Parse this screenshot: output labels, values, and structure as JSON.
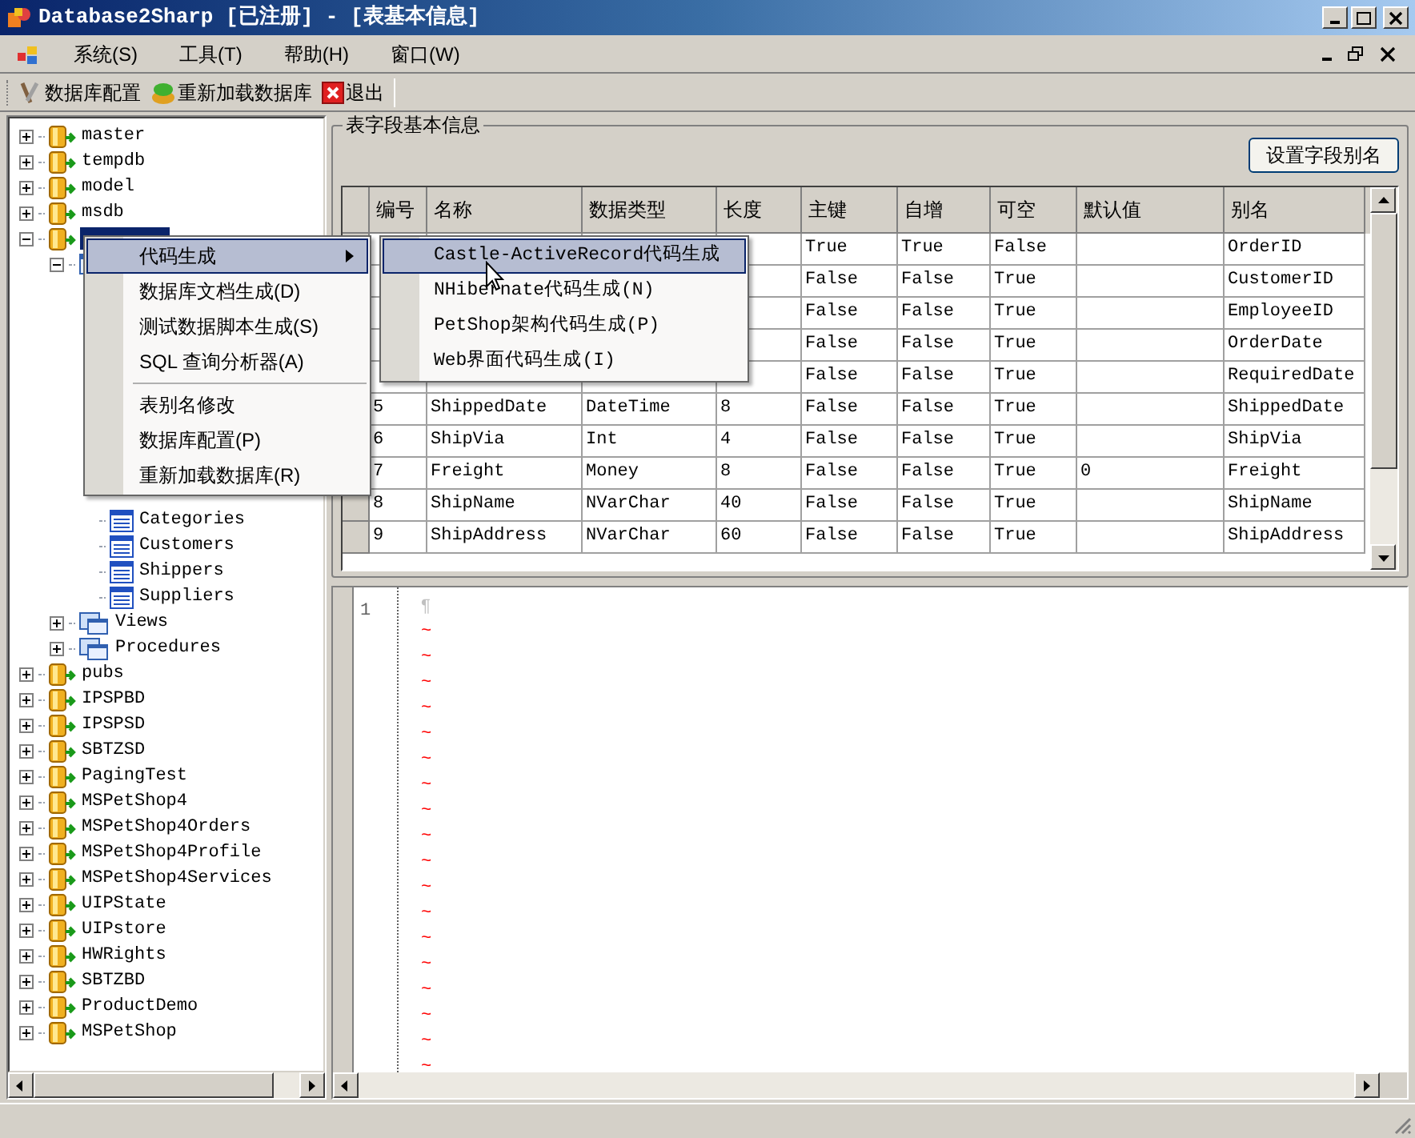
{
  "window": {
    "title": "Database2Sharp [已注册] - [表基本信息]"
  },
  "menu_bar": [
    "系统(S)",
    "工具(T)",
    "帮助(H)",
    "窗口(W)"
  ],
  "toolbar": [
    {
      "label": "数据库配置",
      "kind": "config"
    },
    {
      "label": "重新加载数据库",
      "kind": "reload"
    },
    {
      "label": "退出",
      "kind": "exit"
    }
  ],
  "tree": [
    {
      "label": "master",
      "kind": "database",
      "expanded": false,
      "selected": false
    },
    {
      "label": "tempdb",
      "kind": "database",
      "expanded": false,
      "selected": false
    },
    {
      "label": "model",
      "kind": "database",
      "expanded": false,
      "selected": false
    },
    {
      "label": "msdb",
      "kind": "database",
      "expanded": false,
      "selected": false
    },
    {
      "kind": "database",
      "expanded": true,
      "selected": true,
      "children": [
        {
          "kind": "tables",
          "expanded": true,
          "children": [
            {
              "label": "Categories",
              "kind": "table",
              "selected": false
            },
            {
              "label": "Customers",
              "kind": "table",
              "selected": false
            },
            {
              "label": "Shippers",
              "kind": "table",
              "selected": false
            },
            {
              "label": "Suppliers",
              "kind": "table",
              "selected": false
            }
          ]
        },
        {
          "label": "Views",
          "kind": "views",
          "expanded": false,
          "selected": false
        },
        {
          "label": "Procedures",
          "kind": "procedures",
          "expanded": false,
          "selected": false
        }
      ]
    },
    {
      "label": "pubs",
      "kind": "database",
      "expanded": false,
      "selected": false
    },
    {
      "label": "IPSPBD",
      "kind": "database",
      "expanded": false,
      "selected": false
    },
    {
      "label": "IPSPSD",
      "kind": "database",
      "expanded": false,
      "selected": false
    },
    {
      "label": "SBTZSD",
      "kind": "database",
      "expanded": false,
      "selected": false
    },
    {
      "label": "PagingTest",
      "kind": "database",
      "expanded": false,
      "selected": false
    },
    {
      "label": "MSPetShop4",
      "kind": "database",
      "expanded": false,
      "selected": false
    },
    {
      "label": "MSPetShop4Orders",
      "kind": "database",
      "expanded": false,
      "selected": false
    },
    {
      "label": "MSPetShop4Profile",
      "kind": "database",
      "expanded": false,
      "selected": false
    },
    {
      "label": "MSPetShop4Services",
      "kind": "database",
      "expanded": false,
      "selected": false
    },
    {
      "label": "UIPState",
      "kind": "database",
      "expanded": false,
      "selected": false
    },
    {
      "label": "UIPstore",
      "kind": "database",
      "expanded": false,
      "selected": false
    },
    {
      "label": "HWRights",
      "kind": "database",
      "expanded": false,
      "selected": false
    },
    {
      "label": "SBTZBD",
      "kind": "database",
      "expanded": false,
      "selected": false
    },
    {
      "label": "ProductDemo",
      "kind": "database",
      "expanded": false,
      "selected": false
    },
    {
      "label": "MSPetShop",
      "kind": "database",
      "expanded": false,
      "selected": false
    }
  ],
  "field_group": {
    "title": "表字段基本信息",
    "button": "设置字段别名"
  },
  "grid": {
    "columns": [
      "编号",
      "名称",
      "数据类型",
      "长度",
      "主键",
      "自增",
      "可空",
      "默认值",
      "别名"
    ],
    "rows": [
      {
        "primary_key": "True",
        "identity": "True",
        "nullable": "False",
        "alias": "OrderID"
      },
      {
        "primary_key": "False",
        "identity": "False",
        "nullable": "True",
        "alias": "CustomerID"
      },
      {
        "primary_key": "False",
        "identity": "False",
        "nullable": "True",
        "alias": "EmployeeID"
      },
      {
        "primary_key": "False",
        "identity": "False",
        "nullable": "True",
        "alias": "OrderDate"
      },
      {
        "primary_key": "False",
        "identity": "False",
        "nullable": "True",
        "alias": "RequiredDate"
      },
      {
        "number": "5",
        "name": "ShippedDate",
        "type": "DateTime",
        "length": "8",
        "primary_key": "False",
        "identity": "False",
        "nullable": "True",
        "alias": "ShippedDate"
      },
      {
        "number": "6",
        "name": "ShipVia",
        "type": "Int",
        "length": "4",
        "primary_key": "False",
        "identity": "False",
        "nullable": "True",
        "alias": "ShipVia"
      },
      {
        "number": "7",
        "name": "Freight",
        "type": "Money",
        "length": "8",
        "primary_key": "False",
        "identity": "False",
        "nullable": "True",
        "default": "0",
        "alias": "Freight"
      },
      {
        "number": "8",
        "name": "ShipName",
        "type": "NVarChar",
        "length": "40",
        "primary_key": "False",
        "identity": "False",
        "nullable": "True",
        "alias": "ShipName"
      },
      {
        "number": "9",
        "name": "ShipAddress",
        "type": "NVarChar",
        "length": "60",
        "primary_key": "False",
        "identity": "False",
        "nullable": "True",
        "alias": "ShipAddress"
      }
    ]
  },
  "editor": {
    "line_number": "1",
    "pilcrow": "¶",
    "tildes": [
      "~",
      "~",
      "~",
      "~",
      "~",
      "~",
      "~",
      "~",
      "~",
      "~",
      "~",
      "~",
      "~",
      "~",
      "~",
      "~",
      "~",
      "~"
    ]
  },
  "context_menu": {
    "items": [
      {
        "kind": "item",
        "label": "代码生成",
        "has_submenu": true,
        "selected": true
      },
      {
        "kind": "item",
        "label": "数据库文档生成(D)",
        "has_submenu": false,
        "selected": false
      },
      {
        "kind": "item",
        "label": "测试数据脚本生成(S)",
        "has_submenu": false,
        "selected": false
      },
      {
        "kind": "item",
        "label": "SQL 查询分析器(A)",
        "has_submenu": false,
        "selected": false
      },
      {
        "kind": "separator"
      },
      {
        "kind": "item",
        "label": "表别名修改",
        "has_submenu": false,
        "selected": false
      },
      {
        "kind": "item",
        "label": "数据库配置(P)",
        "has_submenu": false,
        "selected": false
      },
      {
        "kind": "item",
        "label": "重新加载数据库(R)",
        "has_submenu": false,
        "selected": false
      }
    ],
    "submenu": [
      {
        "label": "Castle-ActiveRecord代码生成",
        "selected": true
      },
      {
        "label": "NHibernate代码生成(N)",
        "selected": false
      },
      {
        "label": "PetShop架构代码生成(P)",
        "selected": false
      },
      {
        "label": "Web界面代码生成(I)",
        "selected": false
      }
    ]
  }
}
